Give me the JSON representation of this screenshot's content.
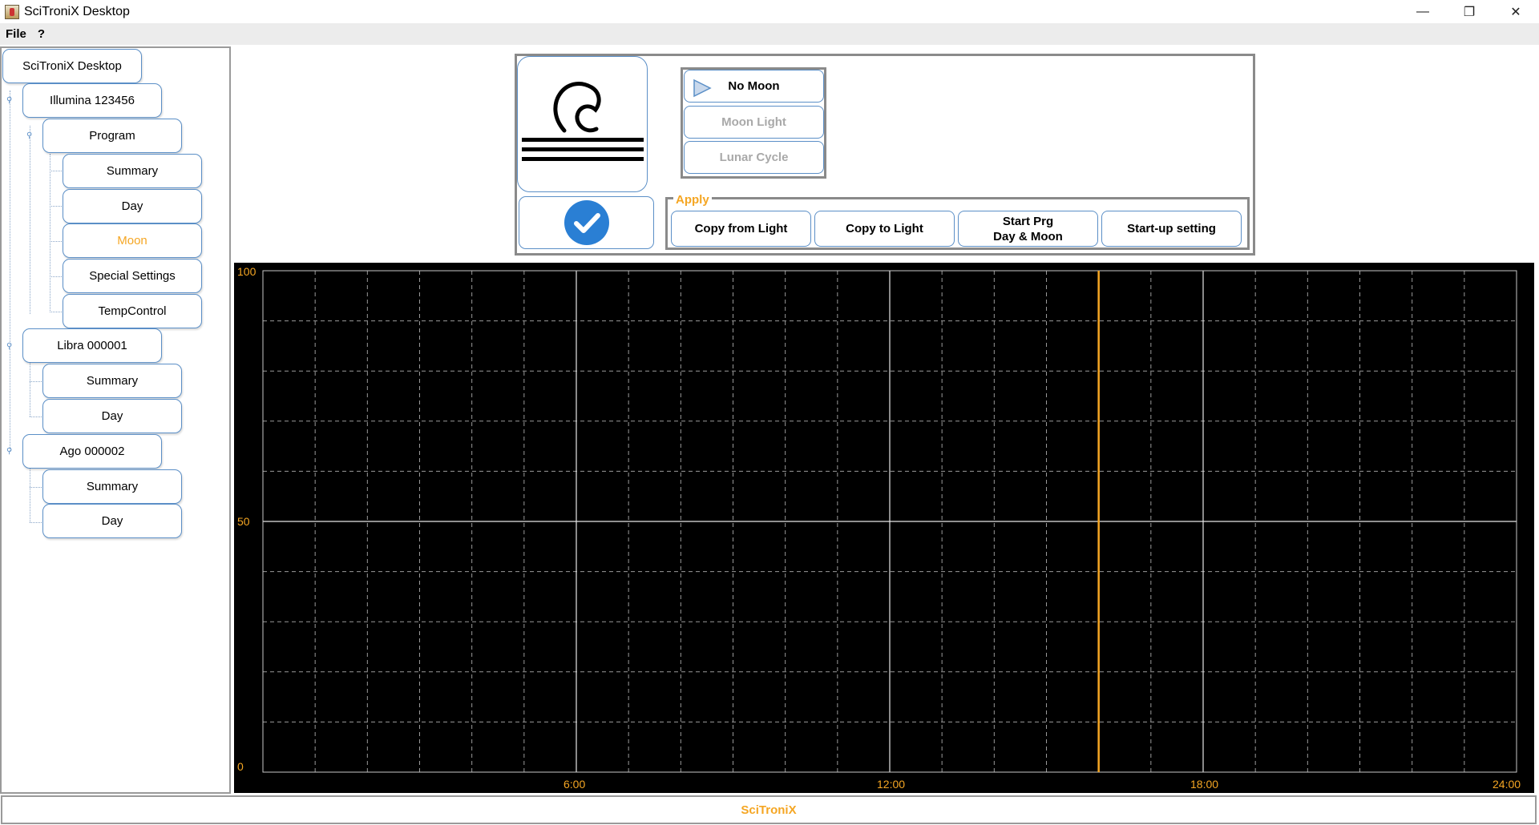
{
  "window": {
    "title": "SciTroniX Desktop"
  },
  "menu": {
    "file": "File",
    "help": "?"
  },
  "tree": {
    "root": "SciTroniX Desktop",
    "devices": [
      {
        "name": "Illumina 123456",
        "program": "Program",
        "items": [
          "Summary",
          "Day",
          "Moon",
          "Special Settings",
          "TempControl"
        ],
        "active": "Moon"
      },
      {
        "name": "Libra 000001",
        "items": [
          "Summary",
          "Day"
        ]
      },
      {
        "name": "Ago 000002",
        "items": [
          "Summary",
          "Day"
        ]
      }
    ]
  },
  "moon_modes": [
    {
      "label": "No Moon",
      "selected": true
    },
    {
      "label": "Moon Light",
      "enabled": false
    },
    {
      "label": "Lunar Cycle",
      "enabled": false
    }
  ],
  "apply": {
    "legend": "Apply",
    "buttons": [
      "Copy  from  Light",
      "Copy  to  Light",
      "Start Prg\nDay & Moon",
      "Start-up setting"
    ]
  },
  "chart_data": {
    "type": "line",
    "y_ticks": [
      "100",
      "50",
      "0"
    ],
    "x_ticks": [
      "6:00",
      "12:00",
      "18:00",
      "24:00"
    ],
    "ylim": [
      0,
      100
    ],
    "xlim": [
      0,
      24
    ],
    "current_time_hours": 16.0,
    "grid": true,
    "series": []
  },
  "status": {
    "text": "SciTroniX"
  },
  "colors": {
    "accent": "#f5a623",
    "border": "#5b8fc7",
    "chart_bg": "#000000",
    "check": "#2a7fd4"
  },
  "icons": {
    "moon_tile": "moon-over-water-icon",
    "apply_tile": "checkmark-icon",
    "play": "play-icon"
  }
}
